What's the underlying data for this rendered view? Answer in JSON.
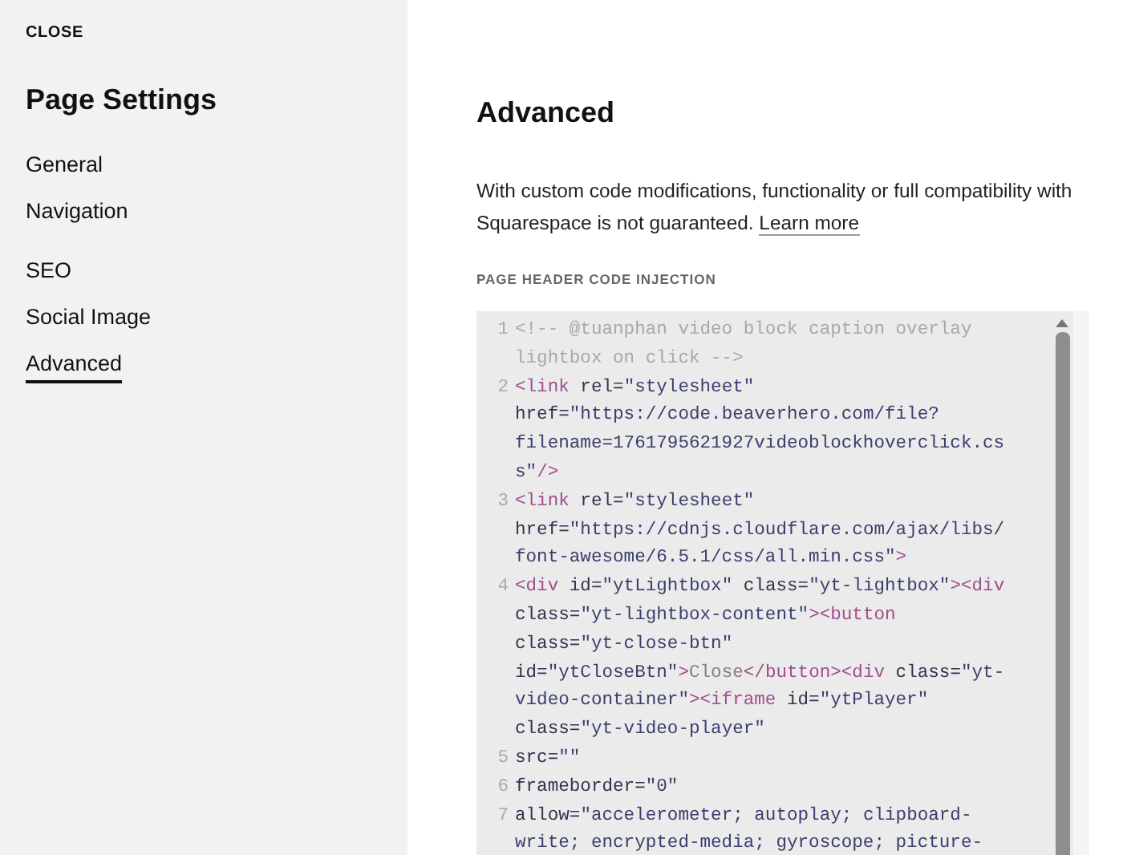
{
  "sidebar": {
    "close": "CLOSE",
    "title": "Page Settings",
    "groups": [
      {
        "items": [
          {
            "label": "General",
            "selected": false
          },
          {
            "label": "Navigation",
            "selected": false
          }
        ]
      },
      {
        "items": [
          {
            "label": "SEO",
            "selected": false
          },
          {
            "label": "Social Image",
            "selected": false
          },
          {
            "label": "Advanced",
            "selected": true
          }
        ]
      }
    ]
  },
  "main": {
    "title": "Advanced",
    "description": "With custom code modifications, functionality or full compatibility with Squarespace is not guaranteed.",
    "link": "Learn more",
    "field_label": "PAGE HEADER CODE INJECTION",
    "code": [
      {
        "number": "1",
        "rows": [
          "<!-- @tuanphan video block caption overlay",
          "lightbox on click -->"
        ]
      },
      {
        "number": "2",
        "rows": [
          "<link rel=\"stylesheet\"",
          "href=\"https://code.beaverhero.com/file?",
          "filename=1761795621927videoblockhoverclick.cs",
          "s\"/>"
        ]
      },
      {
        "number": "3",
        "rows": [
          "<link rel=\"stylesheet\"",
          "href=\"https://cdnjs.cloudflare.com/ajax/libs/",
          "font-awesome/6.5.1/css/all.min.css\">"
        ]
      },
      {
        "number": "4",
        "rows": [
          "<div id=\"ytLightbox\" class=\"yt-lightbox\"><div",
          "class=\"yt-lightbox-content\"><button",
          "class=\"yt-close-btn\"",
          "id=\"ytCloseBtn\">Close</button><div class=\"yt-",
          "video-container\"><iframe id=\"ytPlayer\"",
          "class=\"yt-video-player\""
        ]
      },
      {
        "number": "5",
        "rows": [
          "src=\"\""
        ]
      },
      {
        "number": "6",
        "rows": [
          "frameborder=\"0\""
        ]
      },
      {
        "number": "7",
        "rows": [
          "allow=\"accelerometer; autoplay; clipboard-",
          "write; encrypted-media; gyroscope; picture-"
        ]
      }
    ]
  }
}
